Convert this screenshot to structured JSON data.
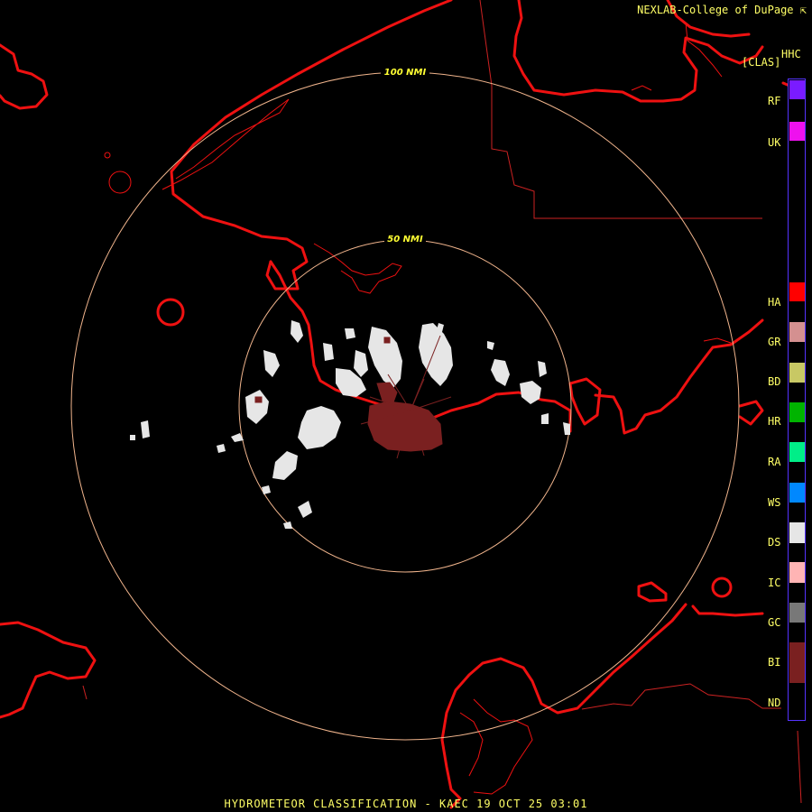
{
  "header": {
    "credit": "NEXLAB-College of DuPage",
    "credit_icon": "arrow-corner-icon",
    "product_code": "HHC",
    "product_name": "[CLAS]"
  },
  "footer": {
    "title": "HYDROMETEOR CLASSIFICATION - KAEC 19 OCT 25 03:01"
  },
  "range_rings": [
    {
      "label": "50 NMI"
    },
    {
      "label": "100 NMI"
    }
  ],
  "legend": {
    "classes": [
      {
        "code": "RF",
        "color": "#7a1bff"
      },
      {
        "code": "UK",
        "color": "#ee11ee"
      },
      {
        "code": "HA",
        "color": "#ff0000"
      },
      {
        "code": "GR",
        "color": "#d49090"
      },
      {
        "code": "BD",
        "color": "#c8c864"
      },
      {
        "code": "HR",
        "color": "#00b400"
      },
      {
        "code": "RA",
        "color": "#00ee88"
      },
      {
        "code": "WS",
        "color": "#0088ff"
      },
      {
        "code": "DS",
        "color": "#e6e6e6"
      },
      {
        "code": "IC",
        "color": "#ffb4b4"
      },
      {
        "code": "GC",
        "color": "#787878"
      },
      {
        "code": "BI",
        "color": "#7a2020"
      },
      {
        "code": "ND",
        "color": "#000000"
      }
    ]
  },
  "colors": {
    "coastline": "#ee1111",
    "border": "#cc2222",
    "ring": "#f0b48c",
    "text": "#ffff66"
  }
}
